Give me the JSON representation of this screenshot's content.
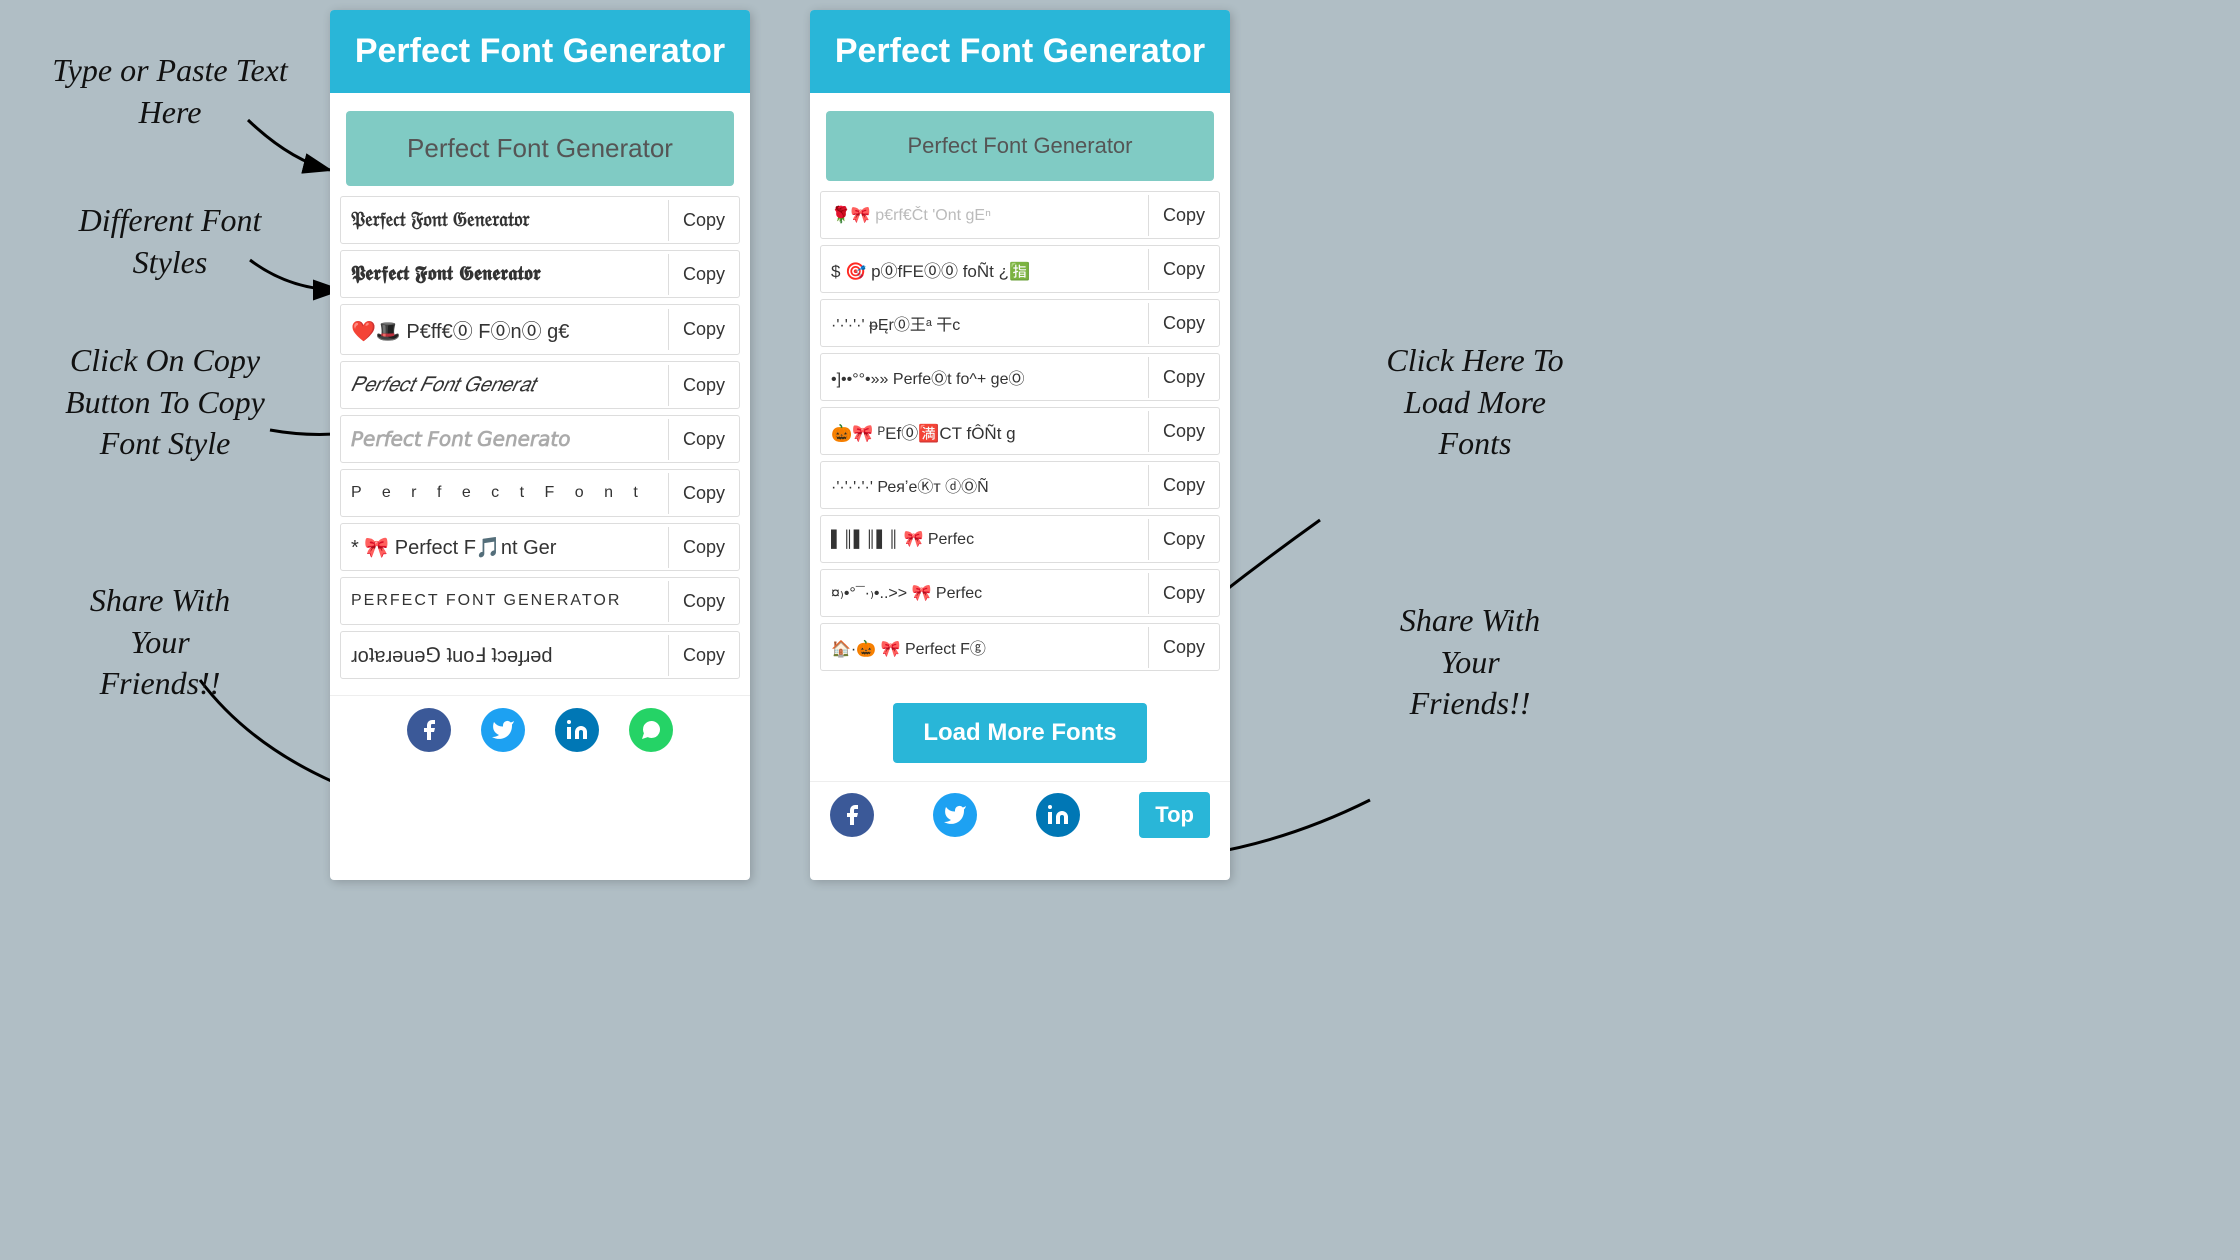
{
  "annotations": {
    "type_paste": "Type or Paste Text\nHere",
    "diff_font": "Different Font\nStyles",
    "click_copy": "Click On Copy\nButton To Copy\nFont Style",
    "share": "Share With\nYour\nFriends!!",
    "click_load": "Click Here To\nLoad More\nFonts",
    "share2": "Share With\nYour\nFriends!!"
  },
  "header": "Perfect Font Generator",
  "input_placeholder": "Perfect Font Generator",
  "panel2_header": "Perfect Font Generator",
  "panel2_input": "Perfect Font Generator",
  "fonts_panel1": [
    {
      "text": "𝔓𝔢𝔯𝔣𝔢𝔠𝔱 𝔉𝔬𝔫𝔱 𝔊𝔢𝔫𝔢𝔯𝔞𝔱𝔬𝔯",
      "style": "gothic"
    },
    {
      "text": "𝕻𝖊𝖗𝖋𝖊𝖈𝖙 𝕱𝖔𝖓𝖙 𝕲𝖊𝖓𝖊𝖗𝖆𝖙𝖔𝖗",
      "style": "blackletter"
    },
    {
      "text": "❤️🎩 P€ff€⓪ F⓪n⓪ g€",
      "style": "emoji"
    },
    {
      "text": "𝑃𝑒𝑟𝑓𝑒𝑐𝑡 𝐹𝑜𝑛𝑡 𝐺𝑒𝑛𝑒𝑟𝑎𝑡",
      "style": "italic"
    },
    {
      "text": "𝘗𝘦𝘳𝘧𝘦𝘤𝘵 𝘍𝘰𝘯𝘵 𝘎𝘦𝘯𝘦𝘳𝘢𝘵𝘰",
      "style": "bold-italic"
    },
    {
      "text": "P e r f e c t  F o n t",
      "style": "spaced"
    },
    {
      "text": "* 🎀 Perfect F🎵nt Ger",
      "style": "emoji2"
    },
    {
      "text": "PERFECT FONT GENERATOR",
      "style": "caps"
    },
    {
      "text": "ɹoʇɐɹǝuǝ⅁ ʇuoℲ ʇɔǝɟɹǝd",
      "style": "flipped"
    }
  ],
  "fonts_panel2": [
    {
      "text": "🌹🎀 p€rf€Ct 'Ont gEⁿ",
      "style": "emoji"
    },
    {
      "text": "$ 🎯 p⓪fFE⓪⓪ foÑt ¿🈯",
      "style": "emoji2"
    },
    {
      "text": "·'·'·'·' ᵽĘr⓪王ᵃ 干c",
      "style": "dots"
    },
    {
      "text": "•]••°°•»» PеrfеⓄt fo^+ geⓄ",
      "style": "fancy"
    },
    {
      "text": "🎃🎀 ᴾEf⓪🈵CT fÔÑt g",
      "style": "emoji3"
    },
    {
      "text": "·'·'·'·'·' РеяʼеⓀт ⓓⓄÑ",
      "style": "dots2"
    },
    {
      "text": "▌║▌║▌║ 🎀 Perfec",
      "style": "bar"
    },
    {
      "text": "¤₎•°¯·₎•..>> 🎀 Perfec",
      "style": "fancy2"
    },
    {
      "text": "🏠·🎃 🎀 Perfect Fⓖ",
      "style": "emoji4"
    }
  ],
  "load_more": "Load More Fonts",
  "top": "Top",
  "copy": "Copy",
  "social": {
    "facebook": "f",
    "twitter": "t",
    "linkedin": "in",
    "whatsapp": "w"
  }
}
